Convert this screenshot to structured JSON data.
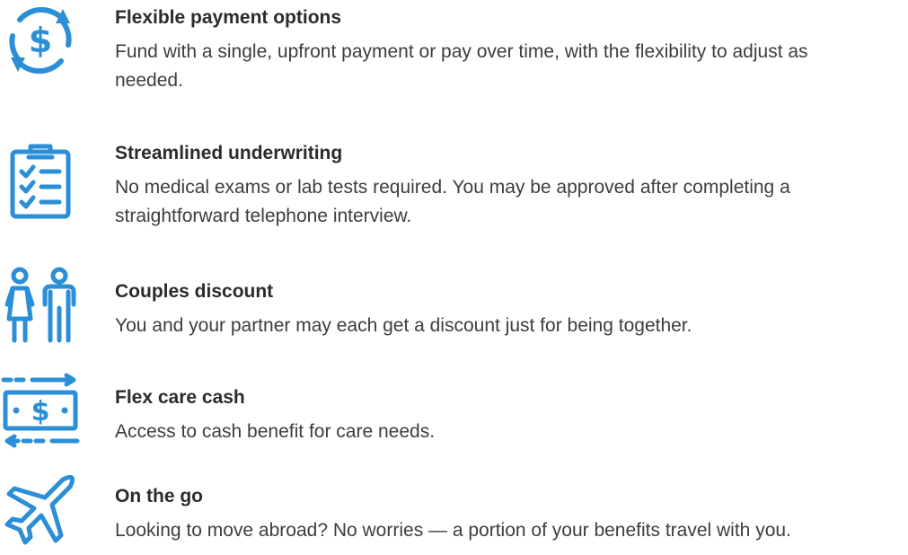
{
  "accent_color": "#2a8fd6",
  "features": [
    {
      "icon": "dollar-cycle-icon",
      "title": "Flexible payment options",
      "description": "Fund with a single, upfront payment or pay over time, with the flexibility to adjust as needed."
    },
    {
      "icon": "clipboard-checklist-icon",
      "title": "Streamlined underwriting",
      "description": "No medical exams or lab tests required. You may be approved after completing a straightforward telephone interview."
    },
    {
      "icon": "couple-icon",
      "title": "Couples discount",
      "description": "You and your partner may each get a discount just for being together."
    },
    {
      "icon": "cash-transfer-icon",
      "title": "Flex care cash",
      "description": "Access to cash benefit for care needs."
    },
    {
      "icon": "airplane-icon",
      "title": "On the go",
      "description": "Looking to move abroad? No worries — a portion of your benefits travel with you."
    }
  ]
}
